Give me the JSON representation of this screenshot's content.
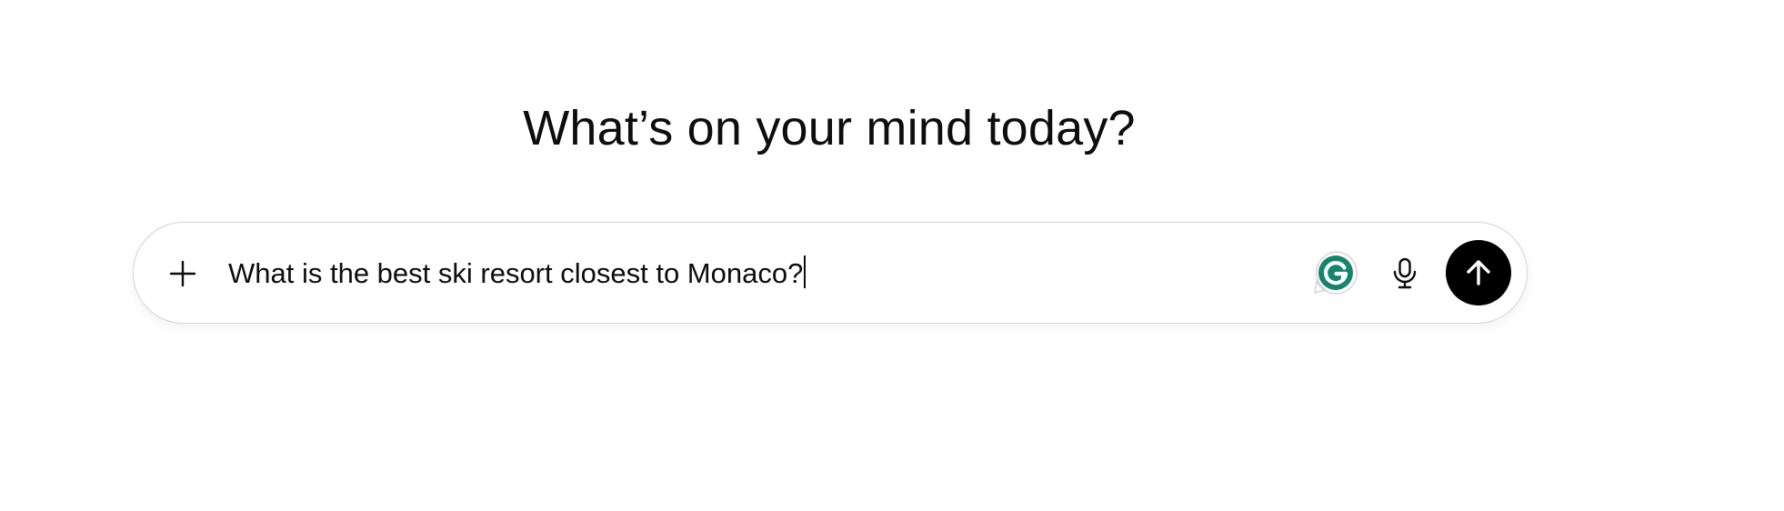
{
  "headline": "What’s on your mind today?",
  "composer": {
    "input_value": "What is the best ski resort closest to Monaco?",
    "icons": {
      "attach": "plus-icon",
      "grammarly": "grammarly-g-icon",
      "voice": "microphone-icon",
      "send": "arrow-up-icon"
    },
    "colors": {
      "send_button": "#000000",
      "grammarly": "#15846f"
    }
  }
}
